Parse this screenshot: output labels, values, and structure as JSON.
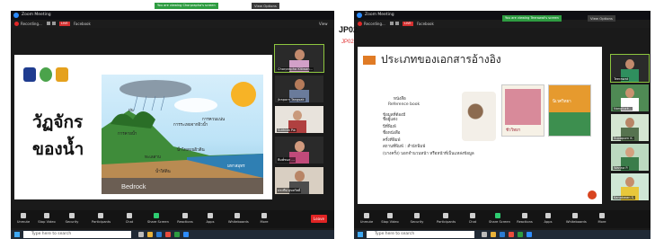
{
  "left_window": {
    "title": "Zoom Meeting",
    "recording_label": "Recording...",
    "live_label": "LIVE",
    "facebook_label": "Facebook",
    "status_bar": "You are viewing Chorprapha's screen",
    "view_options": "View Options",
    "view_label": "View",
    "slide": {
      "title_line1": "วัฏจักร",
      "title_line2": "ของน้ำ",
      "diagram_labels": [
        "ฝน",
        "การระเหยจากผิวน้ำ",
        "การควบแน่น",
        "การคายน้ำ",
        "น้ำไหลบนผิวดิน",
        "ทะเลสาบ",
        "น้ำใต้ดิน",
        "มหาสมุทร"
      ],
      "bedrock_label": "Bedrock"
    },
    "participants": [
      {
        "name": "Chorprapha Kitiwan..."
      },
      {
        "name": "Jiraporn Tangsak"
      },
      {
        "name": "Suthida Pw"
      },
      {
        "name": "พิมพ์ชนก ..."
      },
      {
        "name": "ประทีป สุขสวัสดิ์"
      }
    ],
    "toolbar": [
      {
        "label": "Unmute"
      },
      {
        "label": "Stop Video"
      },
      {
        "label": "Security"
      },
      {
        "label": "Participants",
        "count": "75"
      },
      {
        "label": "Chat"
      },
      {
        "label": "Share Screen"
      },
      {
        "label": "Reactions"
      },
      {
        "label": "Apps"
      },
      {
        "label": "Whiteboards"
      },
      {
        "label": "More"
      }
    ],
    "end_label": "Leave",
    "taskbar_search": "Type here to search"
  },
  "right_window": {
    "title": "Zoom Meeting",
    "recording_label": "Recording...",
    "live_label": "LIVE",
    "facebook_label": "Facebook",
    "status_bar": "You are viewing Teerawat's screen",
    "view_options": "View Options",
    "jp_label": "JP02",
    "jp_label_small": "JP02",
    "slide": {
      "title": "ประเภทของเอกสารอ้างอิง",
      "subhead": "หนังสือ",
      "subhead2": "Reference book",
      "section_label": "ข้อมูลที่ต้องมี",
      "bullets": [
        "ชื่อผู้แต่ง",
        "ปีที่พิมพ์",
        "ชื่อหนังสือ",
        "ครั้งที่พิมพ์",
        "สถานที่พิมพ์ : สำนักพิมพ์",
        "(บางครั้ง) บอกจำนวนหน้า หรือหน้าที่เป็นแหล่งข้อมูล"
      ],
      "book_titles": [
        "ชีววิทยา",
        "นิเวศวิทยา"
      ]
    },
    "participants": [
      {
        "name": "Teerawat"
      },
      {
        "name": "Nongluck..."
      },
      {
        "name": "Supaporn K."
      },
      {
        "name": "Wanna P."
      },
      {
        "name": "Kanokwan S."
      },
      {
        "name": "..."
      }
    ],
    "toolbar": [
      {
        "label": "Unmute"
      },
      {
        "label": "Stop Video"
      },
      {
        "label": "Security"
      },
      {
        "label": "Participants"
      },
      {
        "label": "Chat"
      },
      {
        "label": "Share Screen"
      },
      {
        "label": "Reactions"
      },
      {
        "label": "Apps"
      },
      {
        "label": "Whiteboards"
      },
      {
        "label": "More"
      }
    ],
    "taskbar_search": "Type here to search"
  },
  "colors": {
    "zoom_dark": "#1a1a1a",
    "live_red": "#d32f2f",
    "status_green": "#2e9c41",
    "accent_orange": "#e07b25"
  }
}
